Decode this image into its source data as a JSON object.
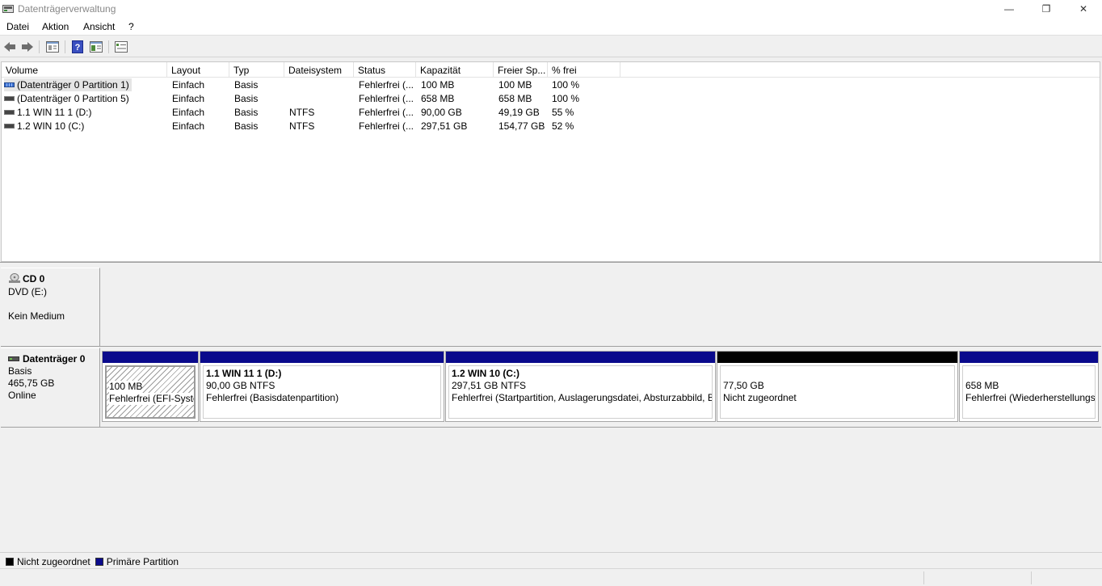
{
  "window": {
    "title": "Datenträgerverwaltung",
    "min_glyph": "—",
    "max_glyph": "❐",
    "close_glyph": "✕"
  },
  "menu": [
    "Datei",
    "Aktion",
    "Ansicht",
    "?"
  ],
  "toolbar": {
    "icons": [
      "back-arrow-icon",
      "forward-arrow-icon",
      "properties-icon",
      "help-icon",
      "disk-list-icon",
      "settings-list-icon"
    ]
  },
  "volume_list": {
    "columns": [
      "Volume",
      "Layout",
      "Typ",
      "Dateisystem",
      "Status",
      "Kapazität",
      "Freier Sp...",
      "% frei"
    ],
    "rows": [
      {
        "volume": "(Datenträger 0 Partition 1)",
        "layout": "Einfach",
        "typ": "Basis",
        "fs": "",
        "status": "Fehlerfrei (...",
        "capacity": "100 MB",
        "free": "100 MB",
        "pct": "100 %",
        "icon": "blue"
      },
      {
        "volume": "(Datenträger 0 Partition 5)",
        "layout": "Einfach",
        "typ": "Basis",
        "fs": "",
        "status": "Fehlerfrei (...",
        "capacity": "658 MB",
        "free": "658 MB",
        "pct": "100 %",
        "icon": "gray"
      },
      {
        "volume": "1.1 WIN 11 1 (D:)",
        "layout": "Einfach",
        "typ": "Basis",
        "fs": "NTFS",
        "status": "Fehlerfrei (...",
        "capacity": "90,00 GB",
        "free": "49,19 GB",
        "pct": "55 %",
        "icon": "gray"
      },
      {
        "volume": "1.2 WIN 10 (C:)",
        "layout": "Einfach",
        "typ": "Basis",
        "fs": "NTFS",
        "status": "Fehlerfrei (...",
        "capacity": "297,51 GB",
        "free": "154,77 GB",
        "pct": "52 %",
        "icon": "gray"
      }
    ]
  },
  "cd": {
    "name": "CD 0",
    "drive": "DVD (E:)",
    "state": "Kein Medium"
  },
  "disk0": {
    "name": "Datenträger 0",
    "type": "Basis",
    "size": "465,75 GB",
    "state": "Online",
    "partitions": [
      {
        "title": "",
        "size": "100 MB",
        "status": "Fehlerfrei (EFI-Systempartition)",
        "kind": "primary",
        "hatched": true
      },
      {
        "title": "1.1 WIN 11 1  (D:)",
        "size": "90,00 GB NTFS",
        "status": "Fehlerfrei (Basisdatenpartition)",
        "kind": "primary",
        "hatched": false
      },
      {
        "title": "1.2 WIN 10  (C:)",
        "size": "297,51 GB NTFS",
        "status": "Fehlerfrei (Startpartition, Auslagerungsdatei, Absturzabbild, Basisdatenpartition)",
        "kind": "primary",
        "hatched": false
      },
      {
        "title": "",
        "size": "77,50 GB",
        "status": "Nicht zugeordnet",
        "kind": "unallocated",
        "hatched": false
      },
      {
        "title": "",
        "size": "658 MB",
        "status": "Fehlerfrei (Wiederherstellungspartition)",
        "kind": "primary",
        "hatched": false
      }
    ]
  },
  "legend": {
    "unallocated": "Nicht zugeordnet",
    "primary": "Primäre Partition",
    "unallocated_color": "#000000",
    "primary_color": "#0a0a8c"
  }
}
